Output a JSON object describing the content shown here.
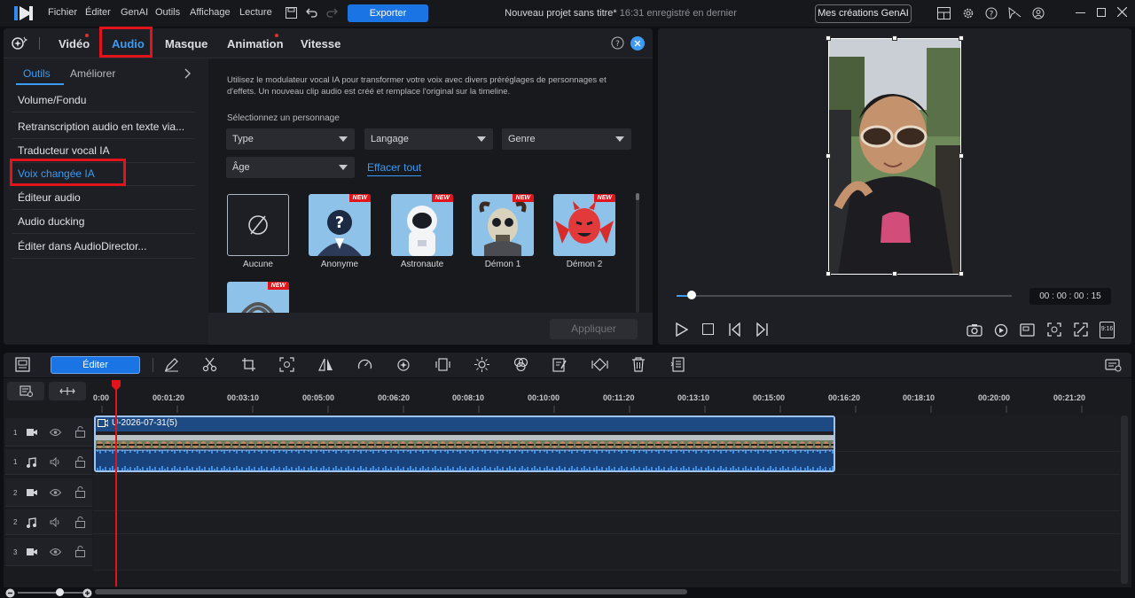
{
  "menu": {
    "items": [
      "Fichier",
      "Éditer",
      "GenAI",
      "Outils",
      "Affichage",
      "Lecture"
    ],
    "export_label": "Exporter",
    "project_title": "Nouveau projet sans titre*",
    "saved_status": "16:31 enregistré en dernier",
    "genai_label": "Mes créations GenAI"
  },
  "tabs": [
    "Vidéo",
    "Audio",
    "Masque",
    "Animation",
    "Vitesse"
  ],
  "subtabs": {
    "tools": "Outils",
    "improve": "Améliorer"
  },
  "sidebar": {
    "items": [
      "Volume/Fondu",
      "Retranscription audio en texte via...",
      "Traducteur vocal IA",
      "Voix changée IA",
      "Éditeur audio",
      "Audio ducking",
      "Éditer dans AudioDirector..."
    ]
  },
  "content": {
    "description": "Utilisez le modulateur vocal IA pour transformer votre voix avec divers préréglages de personnages et d'effets. Un nouveau clip audio est créé et remplace l'original sur la timeline.",
    "select_label": "Sélectionnez un personnage",
    "filters": {
      "type": "Type",
      "language": "Langage",
      "gender": "Genre",
      "age": "Âge"
    },
    "clear_all": "Effacer tout",
    "new_badge": "NEW",
    "characters": [
      "Aucune",
      "Anonyme",
      "Astronaute",
      "Démon 1",
      "Démon 2"
    ],
    "apply_label": "Appliquer"
  },
  "preview": {
    "timecode": "00 : 00 : 00 : 15",
    "aspect": "9:16"
  },
  "timeline": {
    "edit_label": "Éditer",
    "ruler": [
      "0:00",
      "00:01:20",
      "00:03:10",
      "00:05:00",
      "00:06:20",
      "00:08:10",
      "00:10:00",
      "00:11:20",
      "00:13:10",
      "00:15:00",
      "00:16:20",
      "00:18:10",
      "00:20:00",
      "00:21:20"
    ],
    "clip_name": "U-2026-07-31(5)",
    "tracks": [
      "1",
      "1",
      "2",
      "2",
      "3"
    ]
  },
  "colors": {
    "accent": "#1b74e4",
    "highlight": "#e0141a",
    "panel": "#1e1f24"
  }
}
